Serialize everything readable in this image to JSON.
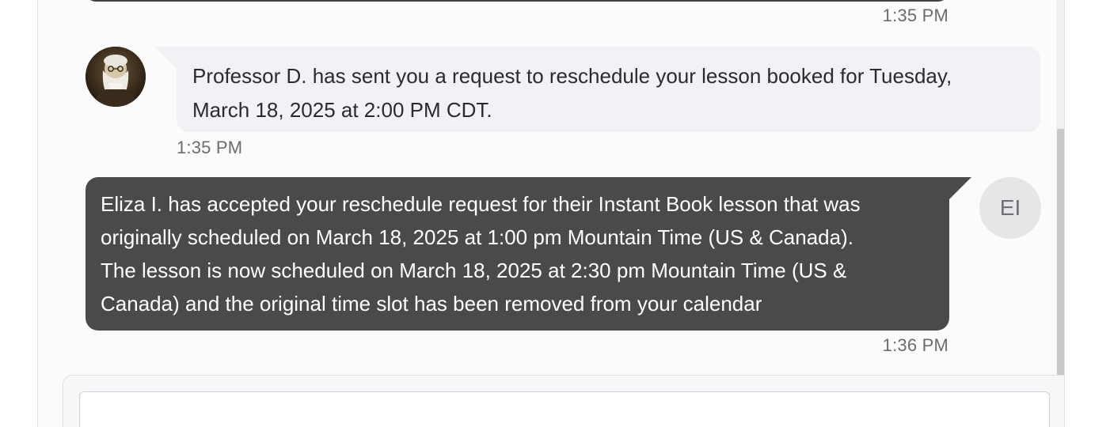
{
  "previous_message": {
    "timestamp": "1:35 PM"
  },
  "messages": [
    {
      "sender_name": "Professor D.",
      "avatar_icon": "user-photo-icon",
      "text_line1": "Professor D. has sent you a request to reschedule your lesson booked for Tuesday,",
      "text_line2": "March 18, 2025 at 2:00 PM CDT.",
      "timestamp": "1:35 PM"
    },
    {
      "avatar_initials": "EI",
      "text_line1": "Eliza I. has accepted your reschedule request for their Instant Book lesson that was",
      "text_line2": "originally scheduled on March 18, 2025 at 1:00 pm Mountain Time (US & Canada).",
      "text_line3": "The lesson is now scheduled on March 18, 2025 at 2:30 pm Mountain Time (US &",
      "text_line4": "Canada) and the original time slot has been removed from your calendar",
      "timestamp": "1:36 PM"
    }
  ],
  "composer": {
    "placeholder": ""
  },
  "colors": {
    "incoming_bubble": "#f1f2f6",
    "outgoing_bubble": "#4a4a4c",
    "timestamp_text": "#6b6b70",
    "initials_avatar_bg": "#e6e6e8"
  }
}
